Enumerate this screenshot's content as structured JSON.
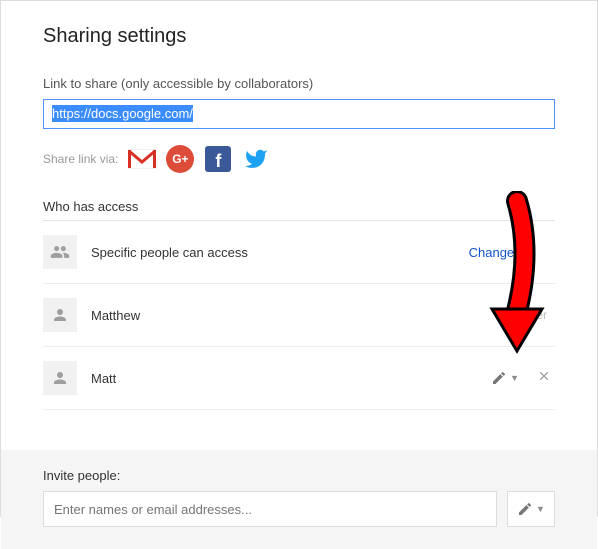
{
  "title": "Sharing settings",
  "linkSection": {
    "label": "Link to share (only accessible by collaborators)",
    "url": "https://docs.google.com/"
  },
  "shareVia": {
    "label": "Share link via:"
  },
  "accessHeader": "Who has access",
  "accessSummary": {
    "text": "Specific people can access",
    "changeLabel": "Change..."
  },
  "people": [
    {
      "name": "Matthew",
      "role": "Is owner"
    },
    {
      "name": "Matt",
      "role": "editor"
    }
  ],
  "invite": {
    "label": "Invite people:",
    "placeholder": "Enter names or email addresses..."
  }
}
